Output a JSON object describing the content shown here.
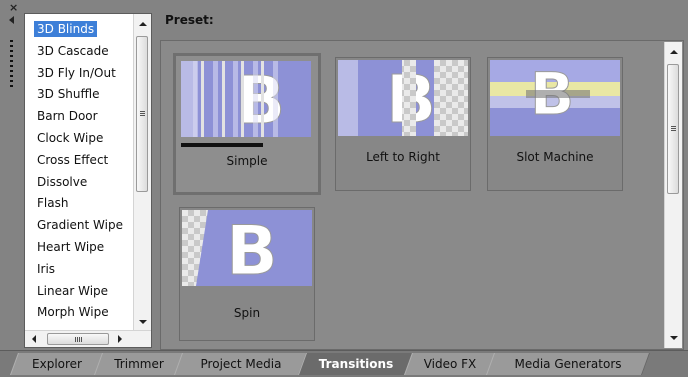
{
  "window": {
    "close_glyph": "×"
  },
  "transitions": {
    "items": [
      {
        "label": "3D Blinds",
        "selected": true
      },
      {
        "label": "3D Cascade"
      },
      {
        "label": "3D Fly In/Out"
      },
      {
        "label": "3D Shuffle"
      },
      {
        "label": "Barn Door"
      },
      {
        "label": "Clock Wipe"
      },
      {
        "label": "Cross Effect"
      },
      {
        "label": "Dissolve"
      },
      {
        "label": "Flash"
      },
      {
        "label": "Gradient Wipe"
      },
      {
        "label": "Heart Wipe"
      },
      {
        "label": "Iris"
      },
      {
        "label": "Linear Wipe"
      },
      {
        "label": "Morph Wipe"
      }
    ]
  },
  "preset": {
    "label": "Preset:",
    "cards": [
      {
        "caption": "Simple",
        "thumb_glyph": "B",
        "selected": true
      },
      {
        "caption": "Left to Right",
        "thumb_glyph": "B"
      },
      {
        "caption": "Slot Machine",
        "thumb_glyph": "B"
      },
      {
        "caption": "Spin",
        "thumb_glyph": "B"
      }
    ]
  },
  "tabs": [
    {
      "label": "Explorer"
    },
    {
      "label": "Trimmer"
    },
    {
      "label": "Project Media"
    },
    {
      "label": "Transitions",
      "active": true
    },
    {
      "label": "Video FX"
    },
    {
      "label": "Media Generators"
    }
  ],
  "colors": {
    "selection": "#3d7fd8",
    "thumb_bg": "#8a8fd8"
  }
}
